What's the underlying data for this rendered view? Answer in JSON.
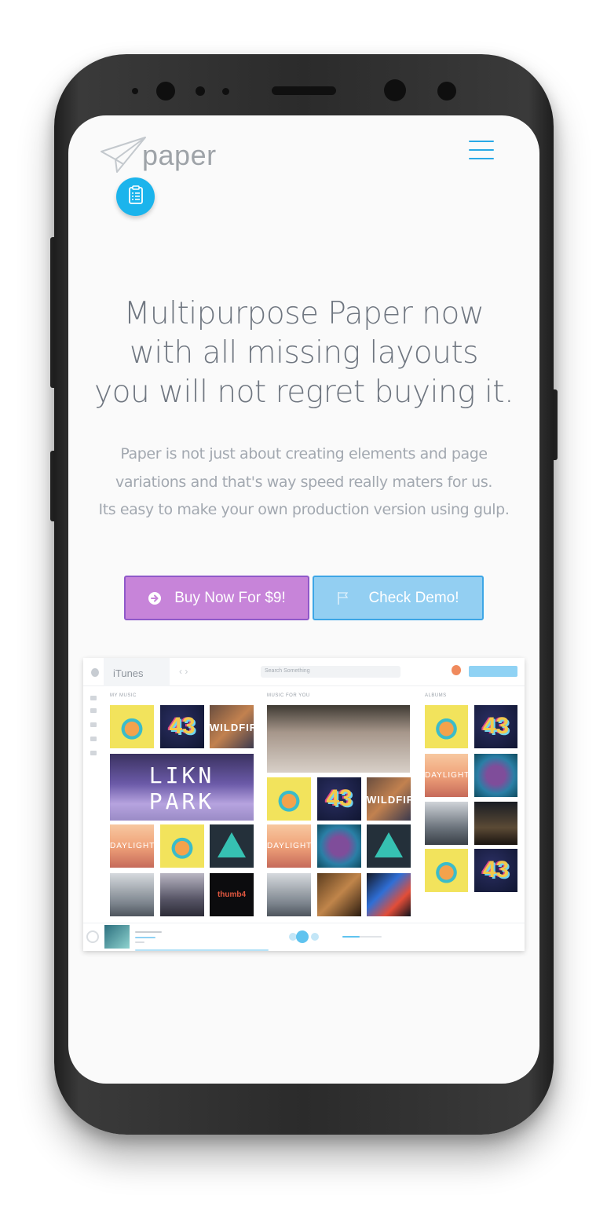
{
  "app": {
    "logo_text": "paper",
    "menu_icon": "hamburger-icon",
    "fab_icon": "clipboard-list-icon"
  },
  "hero": {
    "headline_lines": [
      "Multipurpose Paper now",
      "with all missing layouts",
      "you will not regret buying it."
    ],
    "subtext_lines": [
      "Paper is not just about creating elements and page",
      "variations and that's way speed really maters for us.",
      "Its easy to make your own production version using gulp."
    ]
  },
  "buttons": {
    "buy_label": "Buy Now For $9!",
    "buy_icon": "arrow-circle-right-icon",
    "demo_label": "Check Demo!",
    "demo_icon": "flag-icon"
  },
  "preview": {
    "tab_label": "iTunes",
    "search_placeholder": "Search Something",
    "col1_label": "MY MUSIC",
    "col2_label": "MUSIC FOR YOU",
    "col3_label": "ALBUMS"
  },
  "colors": {
    "accent_blue": "#1bb4ec",
    "buy_purple": "#c784d9",
    "demo_blue": "#93cff2",
    "heading_gray": "#6f7680"
  }
}
